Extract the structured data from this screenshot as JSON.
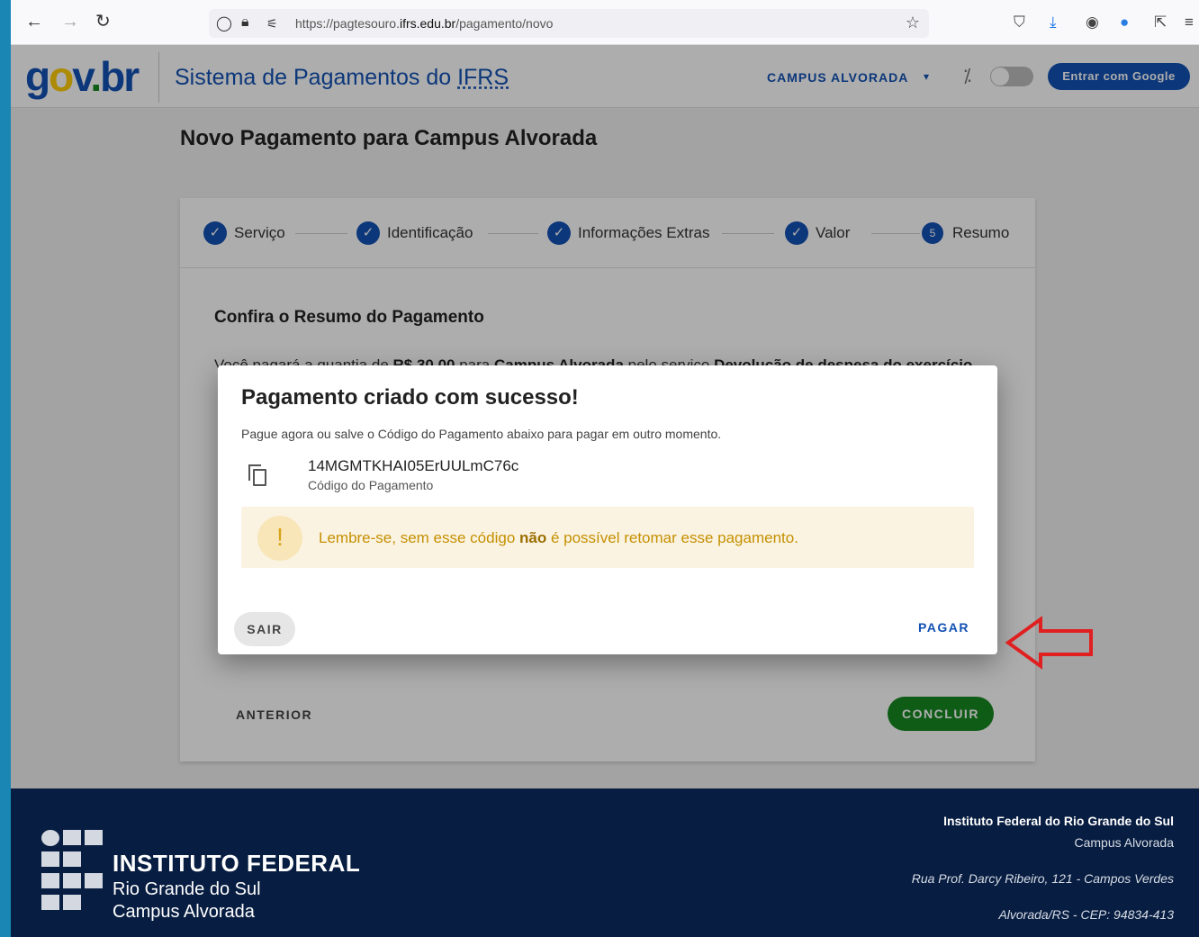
{
  "browser": {
    "url_prefix": "https://pagtesouro.",
    "url_domain": "ifrs.edu.br",
    "url_path": "/pagamento/novo"
  },
  "header": {
    "logo": {
      "g": "g",
      "o": "o",
      "v": "v",
      "dot": ".",
      "b": "br"
    },
    "system_title_prefix": "Sistema de Pagamentos do ",
    "system_title_abbr": "IFRS",
    "campus_select": "CAMPUS ALVORADA",
    "google_button": "Entrar com Google"
  },
  "page": {
    "title": "Novo Pagamento para Campus Alvorada"
  },
  "stepper": {
    "steps": [
      {
        "label": "Serviço",
        "marker": "✓"
      },
      {
        "label": "Identificação",
        "marker": "✓"
      },
      {
        "label": "Informações Extras",
        "marker": "✓"
      },
      {
        "label": "Valor",
        "marker": "✓"
      },
      {
        "label": "Resumo",
        "marker": "5"
      }
    ]
  },
  "summary": {
    "title": "Confira o Resumo do Pagamento",
    "text_1": "Você pagará a quantia de ",
    "amount": "R$ 30,00",
    "text_2": " para ",
    "campus": "Campus Alvorada",
    "text_3": " pelo serviço ",
    "service": "Devolução de despesa do exercício"
  },
  "actions": {
    "previous": "ANTERIOR",
    "finish": "CONCLUIR"
  },
  "dialog": {
    "title": "Pagamento criado com sucesso!",
    "subtitle": "Pague agora ou salve o Código do Pagamento abaixo para pagar em outro momento.",
    "code_value": "14MGMTKHAI05ErUULmC76c",
    "code_label": "Código do Pagamento",
    "alert_icon": "!",
    "alert_text_1": "Lembre-se, sem esse código ",
    "alert_text_bold": "não",
    "alert_text_2": " é possível retomar esse pagamento.",
    "exit_button": "SAIR",
    "pay_button": "PAGAR"
  },
  "footer": {
    "institution_line1": "INSTITUTO FEDERAL",
    "institution_line2": "Rio Grande do Sul",
    "institution_line3": "Campus Alvorada",
    "right_line1": "Instituto Federal do Rio Grande do Sul",
    "right_line2": "Campus Alvorada",
    "right_line3": "Rua Prof. Darcy Ribeiro, 121 - Campos Verdes",
    "right_line4": "Alvorada/RS - CEP: 94834-413"
  },
  "colors": {
    "brand_blue": "#1351b4",
    "success_green": "#168821",
    "footer_navy": "#071d41",
    "warning_text": "#c49000",
    "annotation_red": "#e02020"
  }
}
